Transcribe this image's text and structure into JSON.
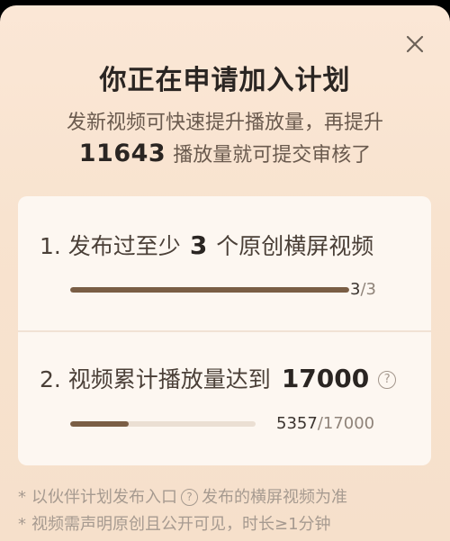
{
  "dialog": {
    "title": "你正在申请加入计划",
    "subtitle_line1": "发新视频可快速提升播放量，再提升",
    "subtitle_number": "11643",
    "subtitle_line2_suffix": "播放量就可提交审核了",
    "close_icon": "close-icon"
  },
  "requirements": [
    {
      "prefix": "1. 发布过至少",
      "highlight": "3",
      "suffix": "个原创横屏视频",
      "progress_current": "3",
      "progress_total": "/3",
      "progress_fraction": 1.0
    },
    {
      "prefix": "2. 视频累计播放量达到",
      "highlight": "17000",
      "suffix": "",
      "help_icon": "help-icon",
      "progress_current": "5357",
      "progress_total": "/17000",
      "progress_fraction": 0.315
    }
  ],
  "notes": [
    {
      "star": "*",
      "text_before": "以伙伴计划发布入口",
      "icon": "help-icon",
      "text_after": "发布的横屏视频为准"
    },
    {
      "star": "*",
      "text": "视频需声明原创且公开可见，时长≥1分钟"
    }
  ],
  "colors": {
    "background": "#f8e3cf",
    "card": "#fdf7f1",
    "progress_fill": "#7a5e45",
    "progress_track": "#ebdfd3"
  }
}
